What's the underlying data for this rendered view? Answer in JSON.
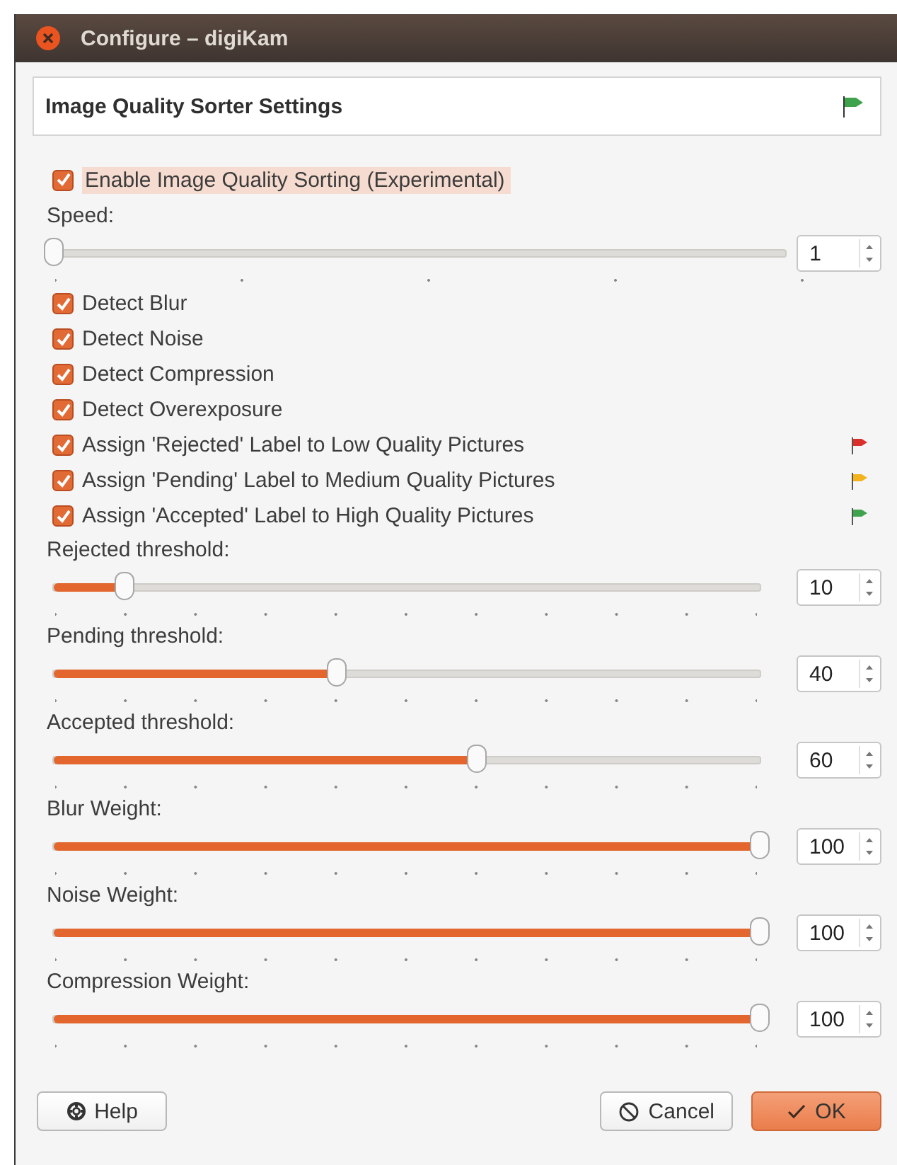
{
  "window": {
    "title": "Configure – digiKam"
  },
  "header": {
    "title": "Image Quality Sorter Settings"
  },
  "enable": {
    "label": "Enable Image Quality Sorting (Experimental)",
    "checked": true
  },
  "speed": {
    "label": "Speed:",
    "level": 0,
    "value": "1"
  },
  "options": [
    {
      "label": "Detect Blur",
      "checked": true
    },
    {
      "label": "Detect Noise",
      "checked": true
    },
    {
      "label": "Detect Compression",
      "checked": true
    },
    {
      "label": "Detect Overexposure",
      "checked": true
    },
    {
      "label": "Assign 'Rejected' Label to Low Quality Pictures",
      "checked": true,
      "color": "#d9302c"
    },
    {
      "label": "Assign 'Pending' Label to Medium Quality Pictures",
      "checked": true,
      "color": "#f2b31c"
    },
    {
      "label": "Assign 'Accepted' Label to High Quality Pictures",
      "checked": true,
      "color": "#3fa34d"
    }
  ],
  "sliders": [
    {
      "label": "Rejected threshold:",
      "level": 0.1,
      "value": "10"
    },
    {
      "label": "Pending threshold:",
      "level": 0.4,
      "value": "40"
    },
    {
      "label": "Accepted threshold:",
      "level": 0.6,
      "value": "60"
    },
    {
      "label": "Blur Weight:",
      "level": 1,
      "value": "100"
    },
    {
      "label": "Noise Weight:",
      "level": 1,
      "value": "100"
    },
    {
      "label": "Compression Weight:",
      "level": 1,
      "value": "100"
    }
  ],
  "buttons": {
    "help": "Help",
    "cancel": "Cancel",
    "ok": "OK"
  }
}
